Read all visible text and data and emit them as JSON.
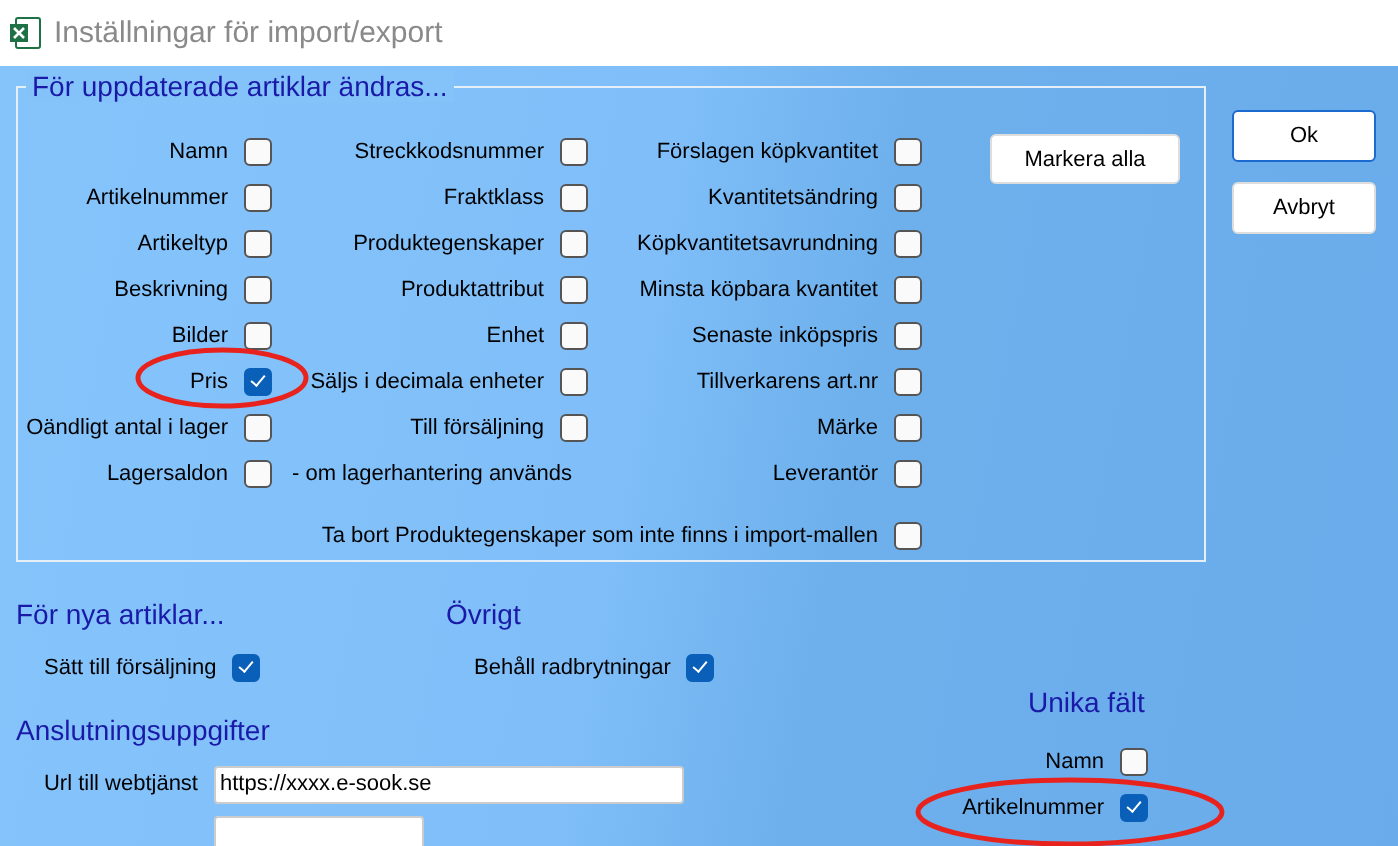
{
  "window": {
    "title": "Inställningar för import/export"
  },
  "update_group": {
    "title": "För uppdaterade artiklar ändras...",
    "columns": [
      [
        {
          "label": "Namn",
          "checked": false
        },
        {
          "label": "Artikelnummer",
          "checked": false
        },
        {
          "label": "Artikeltyp",
          "checked": false
        },
        {
          "label": "Beskrivning",
          "checked": false
        },
        {
          "label": "Bilder",
          "checked": false
        },
        {
          "label": "Pris",
          "checked": true
        },
        {
          "label": "Oändligt antal i lager",
          "checked": false
        }
      ],
      [
        {
          "label": "Streckkodsnummer",
          "checked": false
        },
        {
          "label": "Fraktklass",
          "checked": false
        },
        {
          "label": "Produktegenskaper",
          "checked": false
        },
        {
          "label": "Produktattribut",
          "checked": false
        },
        {
          "label": "Enhet",
          "checked": false
        },
        {
          "label": "Säljs i decimala enheter",
          "checked": false
        },
        {
          "label": "Till försäljning",
          "checked": false
        }
      ],
      [
        {
          "label": "Förslagen köpkvantitet",
          "checked": false
        },
        {
          "label": "Kvantitetsändring",
          "checked": false
        },
        {
          "label": "Köpkvantitetsavrundning",
          "checked": false
        },
        {
          "label": "Minsta köpbara kvantitet",
          "checked": false
        },
        {
          "label": "Senaste inköpspris",
          "checked": false
        },
        {
          "label": "Tillverkarens art.nr",
          "checked": false
        },
        {
          "label": "Märke",
          "checked": false
        },
        {
          "label": "Leverantör",
          "checked": false
        }
      ]
    ],
    "stock_row": {
      "label": "Lagersaldon",
      "checked": false,
      "note": "- om lagerhantering används"
    },
    "remove_row": {
      "label": "Ta bort Produktegenskaper som inte finns i import-mallen",
      "checked": false
    },
    "select_all_button": "Markera alla"
  },
  "buttons": [
    {
      "label": "Ok",
      "default": true
    },
    {
      "label": "Avbryt",
      "default": false
    }
  ],
  "new_articles": {
    "title": "För nya artiklar...",
    "options": [
      {
        "label": "Sätt till försäljning",
        "checked": true
      }
    ]
  },
  "other": {
    "title": "Övrigt",
    "options": [
      {
        "label": "Behåll radbrytningar",
        "checked": true
      }
    ]
  },
  "connection": {
    "title": "Anslutningsuppgifter",
    "fields": [
      {
        "kind": "text",
        "label": "Url till webtjänst",
        "value": "https://xxxx.e-sook.se"
      },
      {
        "kind": "text"
      }
    ]
  },
  "unique_fields": {
    "title": "Unika fält",
    "options": [
      {
        "label": "Namn",
        "checked": false
      },
      {
        "label": "Artikelnummer",
        "checked": true
      }
    ]
  }
}
